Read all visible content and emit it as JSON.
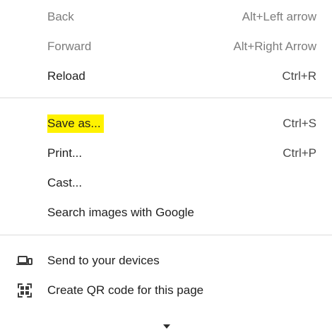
{
  "menu": {
    "items": [
      {
        "label": "Back",
        "shortcut": "Alt+Left arrow"
      },
      {
        "label": "Forward",
        "shortcut": "Alt+Right Arrow"
      },
      {
        "label": "Reload",
        "shortcut": "Ctrl+R"
      },
      {
        "label": "Save as...",
        "shortcut": "Ctrl+S"
      },
      {
        "label": "Print...",
        "shortcut": "Ctrl+P"
      },
      {
        "label": "Cast..."
      },
      {
        "label": "Search images with Google"
      },
      {
        "label": "Send to your devices",
        "icon": "devices-icon"
      },
      {
        "label": "Create QR code for this page",
        "icon": "qr-code-icon"
      }
    ],
    "more_icon": "chevron-down-icon",
    "highlight_color": "#fff200"
  }
}
